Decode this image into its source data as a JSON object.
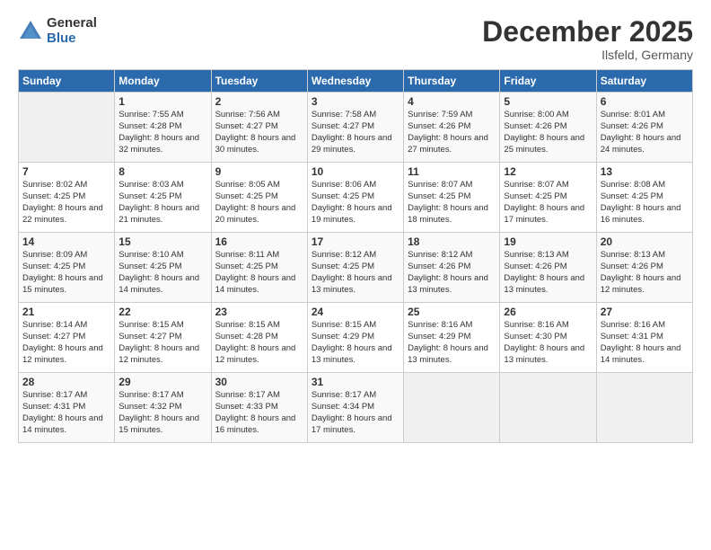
{
  "logo": {
    "general": "General",
    "blue": "Blue"
  },
  "header": {
    "month": "December 2025",
    "location": "Ilsfeld, Germany"
  },
  "weekdays": [
    "Sunday",
    "Monday",
    "Tuesday",
    "Wednesday",
    "Thursday",
    "Friday",
    "Saturday"
  ],
  "weeks": [
    [
      {
        "day": "",
        "sunrise": "",
        "sunset": "",
        "daylight": ""
      },
      {
        "day": "1",
        "sunrise": "Sunrise: 7:55 AM",
        "sunset": "Sunset: 4:28 PM",
        "daylight": "Daylight: 8 hours and 32 minutes."
      },
      {
        "day": "2",
        "sunrise": "Sunrise: 7:56 AM",
        "sunset": "Sunset: 4:27 PM",
        "daylight": "Daylight: 8 hours and 30 minutes."
      },
      {
        "day": "3",
        "sunrise": "Sunrise: 7:58 AM",
        "sunset": "Sunset: 4:27 PM",
        "daylight": "Daylight: 8 hours and 29 minutes."
      },
      {
        "day": "4",
        "sunrise": "Sunrise: 7:59 AM",
        "sunset": "Sunset: 4:26 PM",
        "daylight": "Daylight: 8 hours and 27 minutes."
      },
      {
        "day": "5",
        "sunrise": "Sunrise: 8:00 AM",
        "sunset": "Sunset: 4:26 PM",
        "daylight": "Daylight: 8 hours and 25 minutes."
      },
      {
        "day": "6",
        "sunrise": "Sunrise: 8:01 AM",
        "sunset": "Sunset: 4:26 PM",
        "daylight": "Daylight: 8 hours and 24 minutes."
      }
    ],
    [
      {
        "day": "7",
        "sunrise": "Sunrise: 8:02 AM",
        "sunset": "Sunset: 4:25 PM",
        "daylight": "Daylight: 8 hours and 22 minutes."
      },
      {
        "day": "8",
        "sunrise": "Sunrise: 8:03 AM",
        "sunset": "Sunset: 4:25 PM",
        "daylight": "Daylight: 8 hours and 21 minutes."
      },
      {
        "day": "9",
        "sunrise": "Sunrise: 8:05 AM",
        "sunset": "Sunset: 4:25 PM",
        "daylight": "Daylight: 8 hours and 20 minutes."
      },
      {
        "day": "10",
        "sunrise": "Sunrise: 8:06 AM",
        "sunset": "Sunset: 4:25 PM",
        "daylight": "Daylight: 8 hours and 19 minutes."
      },
      {
        "day": "11",
        "sunrise": "Sunrise: 8:07 AM",
        "sunset": "Sunset: 4:25 PM",
        "daylight": "Daylight: 8 hours and 18 minutes."
      },
      {
        "day": "12",
        "sunrise": "Sunrise: 8:07 AM",
        "sunset": "Sunset: 4:25 PM",
        "daylight": "Daylight: 8 hours and 17 minutes."
      },
      {
        "day": "13",
        "sunrise": "Sunrise: 8:08 AM",
        "sunset": "Sunset: 4:25 PM",
        "daylight": "Daylight: 8 hours and 16 minutes."
      }
    ],
    [
      {
        "day": "14",
        "sunrise": "Sunrise: 8:09 AM",
        "sunset": "Sunset: 4:25 PM",
        "daylight": "Daylight: 8 hours and 15 minutes."
      },
      {
        "day": "15",
        "sunrise": "Sunrise: 8:10 AM",
        "sunset": "Sunset: 4:25 PM",
        "daylight": "Daylight: 8 hours and 14 minutes."
      },
      {
        "day": "16",
        "sunrise": "Sunrise: 8:11 AM",
        "sunset": "Sunset: 4:25 PM",
        "daylight": "Daylight: 8 hours and 14 minutes."
      },
      {
        "day": "17",
        "sunrise": "Sunrise: 8:12 AM",
        "sunset": "Sunset: 4:25 PM",
        "daylight": "Daylight: 8 hours and 13 minutes."
      },
      {
        "day": "18",
        "sunrise": "Sunrise: 8:12 AM",
        "sunset": "Sunset: 4:26 PM",
        "daylight": "Daylight: 8 hours and 13 minutes."
      },
      {
        "day": "19",
        "sunrise": "Sunrise: 8:13 AM",
        "sunset": "Sunset: 4:26 PM",
        "daylight": "Daylight: 8 hours and 13 minutes."
      },
      {
        "day": "20",
        "sunrise": "Sunrise: 8:13 AM",
        "sunset": "Sunset: 4:26 PM",
        "daylight": "Daylight: 8 hours and 12 minutes."
      }
    ],
    [
      {
        "day": "21",
        "sunrise": "Sunrise: 8:14 AM",
        "sunset": "Sunset: 4:27 PM",
        "daylight": "Daylight: 8 hours and 12 minutes."
      },
      {
        "day": "22",
        "sunrise": "Sunrise: 8:15 AM",
        "sunset": "Sunset: 4:27 PM",
        "daylight": "Daylight: 8 hours and 12 minutes."
      },
      {
        "day": "23",
        "sunrise": "Sunrise: 8:15 AM",
        "sunset": "Sunset: 4:28 PM",
        "daylight": "Daylight: 8 hours and 12 minutes."
      },
      {
        "day": "24",
        "sunrise": "Sunrise: 8:15 AM",
        "sunset": "Sunset: 4:29 PM",
        "daylight": "Daylight: 8 hours and 13 minutes."
      },
      {
        "day": "25",
        "sunrise": "Sunrise: 8:16 AM",
        "sunset": "Sunset: 4:29 PM",
        "daylight": "Daylight: 8 hours and 13 minutes."
      },
      {
        "day": "26",
        "sunrise": "Sunrise: 8:16 AM",
        "sunset": "Sunset: 4:30 PM",
        "daylight": "Daylight: 8 hours and 13 minutes."
      },
      {
        "day": "27",
        "sunrise": "Sunrise: 8:16 AM",
        "sunset": "Sunset: 4:31 PM",
        "daylight": "Daylight: 8 hours and 14 minutes."
      }
    ],
    [
      {
        "day": "28",
        "sunrise": "Sunrise: 8:17 AM",
        "sunset": "Sunset: 4:31 PM",
        "daylight": "Daylight: 8 hours and 14 minutes."
      },
      {
        "day": "29",
        "sunrise": "Sunrise: 8:17 AM",
        "sunset": "Sunset: 4:32 PM",
        "daylight": "Daylight: 8 hours and 15 minutes."
      },
      {
        "day": "30",
        "sunrise": "Sunrise: 8:17 AM",
        "sunset": "Sunset: 4:33 PM",
        "daylight": "Daylight: 8 hours and 16 minutes."
      },
      {
        "day": "31",
        "sunrise": "Sunrise: 8:17 AM",
        "sunset": "Sunset: 4:34 PM",
        "daylight": "Daylight: 8 hours and 17 minutes."
      },
      {
        "day": "",
        "sunrise": "",
        "sunset": "",
        "daylight": ""
      },
      {
        "day": "",
        "sunrise": "",
        "sunset": "",
        "daylight": ""
      },
      {
        "day": "",
        "sunrise": "",
        "sunset": "",
        "daylight": ""
      }
    ]
  ]
}
